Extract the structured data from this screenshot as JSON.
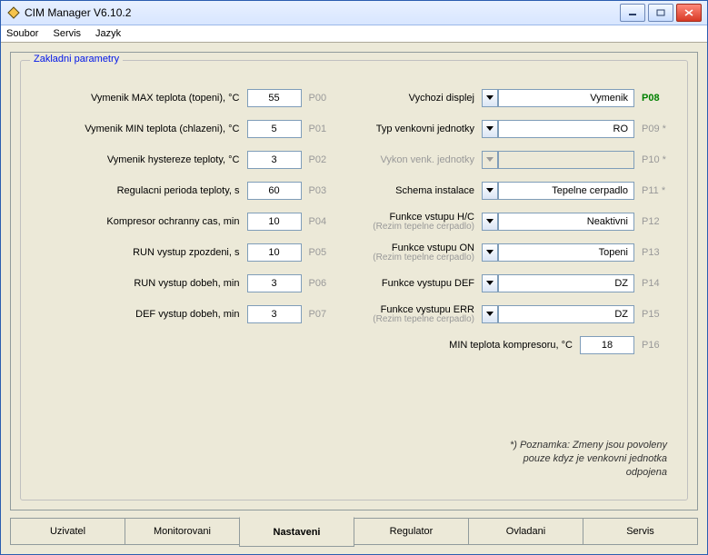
{
  "window": {
    "title": "CIM Manager  V6.10.2"
  },
  "menu": {
    "file": "Soubor",
    "service": "Servis",
    "language": "Jazyk"
  },
  "group": {
    "title": "Zakladni parametry"
  },
  "left": [
    {
      "label": "Vymenik MAX teplota (topeni), °C",
      "value": "55",
      "code": "P00"
    },
    {
      "label": "Vymenik MIN teplota (chlazeni), °C",
      "value": "5",
      "code": "P01"
    },
    {
      "label": "Vymenik hystereze teploty, °C",
      "value": "3",
      "code": "P02"
    },
    {
      "label": "Regulacni perioda teploty, s",
      "value": "60",
      "code": "P03"
    },
    {
      "label": "Kompresor ochranny cas, min",
      "value": "10",
      "code": "P04"
    },
    {
      "label": "RUN vystup zpozdeni, s",
      "value": "10",
      "code": "P05"
    },
    {
      "label": "RUN vystup dobeh, min",
      "value": "3",
      "code": "P06"
    },
    {
      "label": "DEF vystup dobeh, min",
      "value": "3",
      "code": "P07"
    }
  ],
  "right": [
    {
      "label": "Vychozi displej",
      "sub": "",
      "value": "Vymenik",
      "code": "P08",
      "hl": true,
      "star": "",
      "enabled": true
    },
    {
      "label": "Typ venkovni jednotky",
      "sub": "",
      "value": "RO",
      "code": "P09",
      "hl": false,
      "star": " *",
      "enabled": true
    },
    {
      "label": "Vykon venk. jednotky",
      "sub": "",
      "value": "",
      "code": "P10",
      "hl": false,
      "star": " *",
      "enabled": false
    },
    {
      "label": "Schema instalace",
      "sub": "",
      "value": "Tepelne cerpadlo",
      "code": "P11",
      "hl": false,
      "star": " *",
      "enabled": true
    },
    {
      "label": "Funkce vstupu H/C",
      "sub": "(Rezim tepelne cerpadlo)",
      "value": "Neaktivni",
      "code": "P12",
      "hl": false,
      "star": "",
      "enabled": true
    },
    {
      "label": "Funkce vstupu ON",
      "sub": "(Rezim tepelne cerpadlo)",
      "value": "Topeni",
      "code": "P13",
      "hl": false,
      "star": "",
      "enabled": true
    },
    {
      "label": "Funkce vystupu DEF",
      "sub": "",
      "value": "DZ",
      "code": "P14",
      "hl": false,
      "star": "",
      "enabled": true
    },
    {
      "label": "Funkce vystupu ERR",
      "sub": "(Rezim tepelne cerpadlo)",
      "value": "DZ",
      "code": "P15",
      "hl": false,
      "star": "",
      "enabled": true
    }
  ],
  "p16": {
    "label": "MIN teplota kompresoru, °C",
    "value": "18",
    "code": "P16"
  },
  "note": {
    "line1": "*) Poznamka: Zmeny jsou povoleny",
    "line2": "pouze kdyz je venkovni jednotka",
    "line3": "odpojena"
  },
  "tabs": {
    "user": "Uzivatel",
    "monitoring": "Monitorovani",
    "settings": "Nastaveni",
    "regulator": "Regulator",
    "control": "Ovladani",
    "servis": "Servis"
  }
}
